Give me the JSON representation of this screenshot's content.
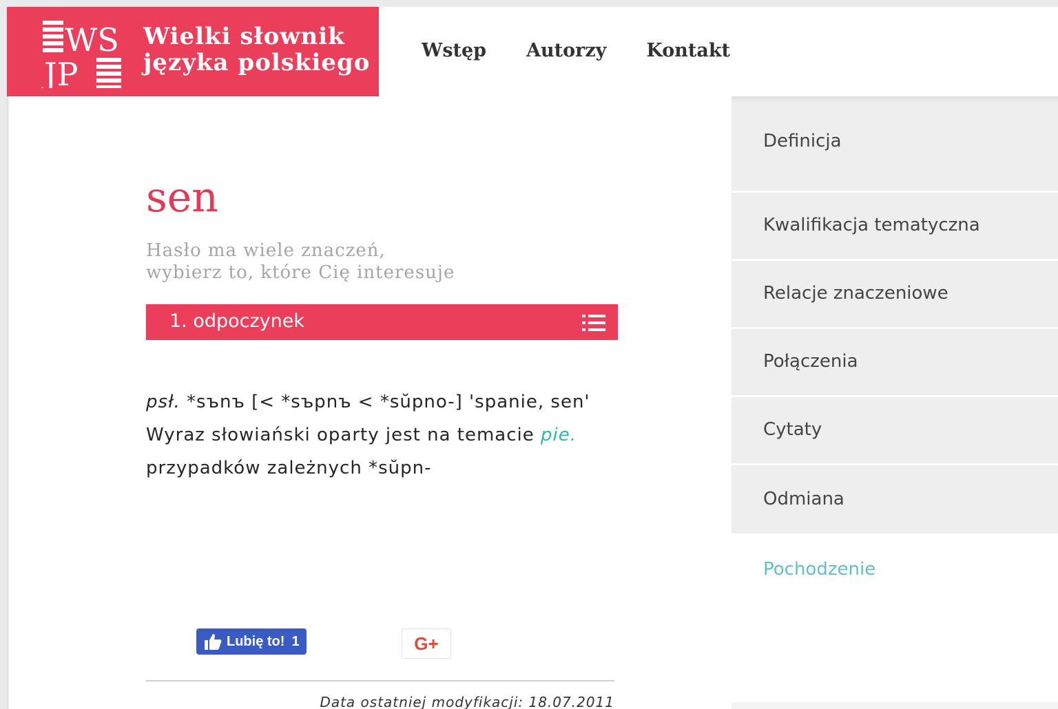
{
  "brand": {
    "logo_text": "WSJP",
    "title_line1": "Wielki słownik",
    "title_line2": "języka polskiego",
    "color": "#eb3e5b"
  },
  "nav": {
    "items": [
      "Wstęp",
      "Autorzy",
      "Kontakt"
    ]
  },
  "entry": {
    "headword": "sen",
    "hint_line1": "Hasło ma wiele znaczeń,",
    "hint_line2": "wybierz to, które Cię interesuje",
    "meaning_label": "1. odpoczynek",
    "meaning_icon": "list-icon"
  },
  "etymology": {
    "line1_abbr": "psł.",
    "line1_rest": " *sъnъ [< *sъpnъ < *sŭpno-] 'spanie, sen'",
    "line2_text": "Wyraz słowiański oparty jest na temacie ",
    "line2_link": "pie.",
    "line3_text": "przypadków zależnych *sŭpn-"
  },
  "social": {
    "fb_label": "Lubię to!",
    "fb_count": "1",
    "gplus_label": "G+"
  },
  "footer": {
    "modified": "Data ostatniej modyfikacji: 18.07.2011"
  },
  "sidebar": {
    "items": [
      "Definicja",
      "Kwalifikacja tematyczna",
      "Relacje znaczeniowe",
      "Połączenia",
      "Cytaty",
      "Odmiana"
    ],
    "active": "Pochodzenie",
    "active_color": "#5fc1c6"
  }
}
